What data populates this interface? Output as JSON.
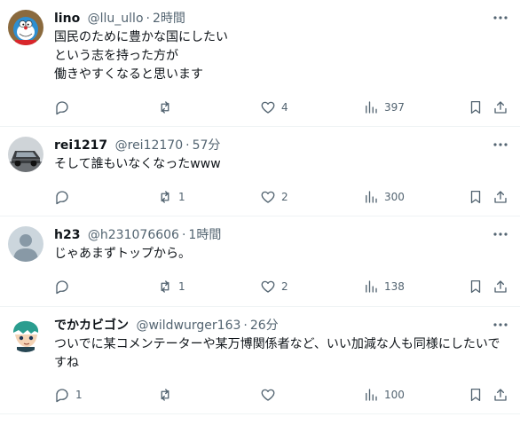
{
  "tweets": [
    {
      "name": "lino",
      "handle": "@llu_ullo",
      "sep": "·",
      "time": "2時間",
      "text": "国民のために豊かな国にしたい\nという志を持った方が\n働きやすくなると思います",
      "replies": "",
      "retweets": "",
      "likes": "4",
      "views": "397",
      "avatar_icon": "robot-cat-avatar"
    },
    {
      "name": "rei1217",
      "handle": "@rei12170",
      "sep": "·",
      "time": "57分",
      "text": "そして誰もいなくなったwww",
      "replies": "",
      "retweets": "1",
      "likes": "2",
      "views": "300",
      "avatar_icon": "car-avatar"
    },
    {
      "name": "h23",
      "handle": "@h231076606",
      "sep": "·",
      "time": "1時間",
      "text": "じゃあまずトップから。",
      "replies": "",
      "retweets": "1",
      "likes": "2",
      "views": "138",
      "avatar_icon": "default-person-avatar"
    },
    {
      "name": "でかカビゴン",
      "handle": "@wildwurger163",
      "sep": "·",
      "time": "26分",
      "text": "ついでに某コメンテーターや某万博関係者など、いい加減な人も同様にしたいですね",
      "replies": "1",
      "retweets": "",
      "likes": "",
      "views": "100",
      "avatar_icon": "cartoon-character-avatar"
    }
  ],
  "colors": {
    "text_primary": "#0f1419",
    "text_secondary": "#536471",
    "divider": "#eff3f4"
  }
}
